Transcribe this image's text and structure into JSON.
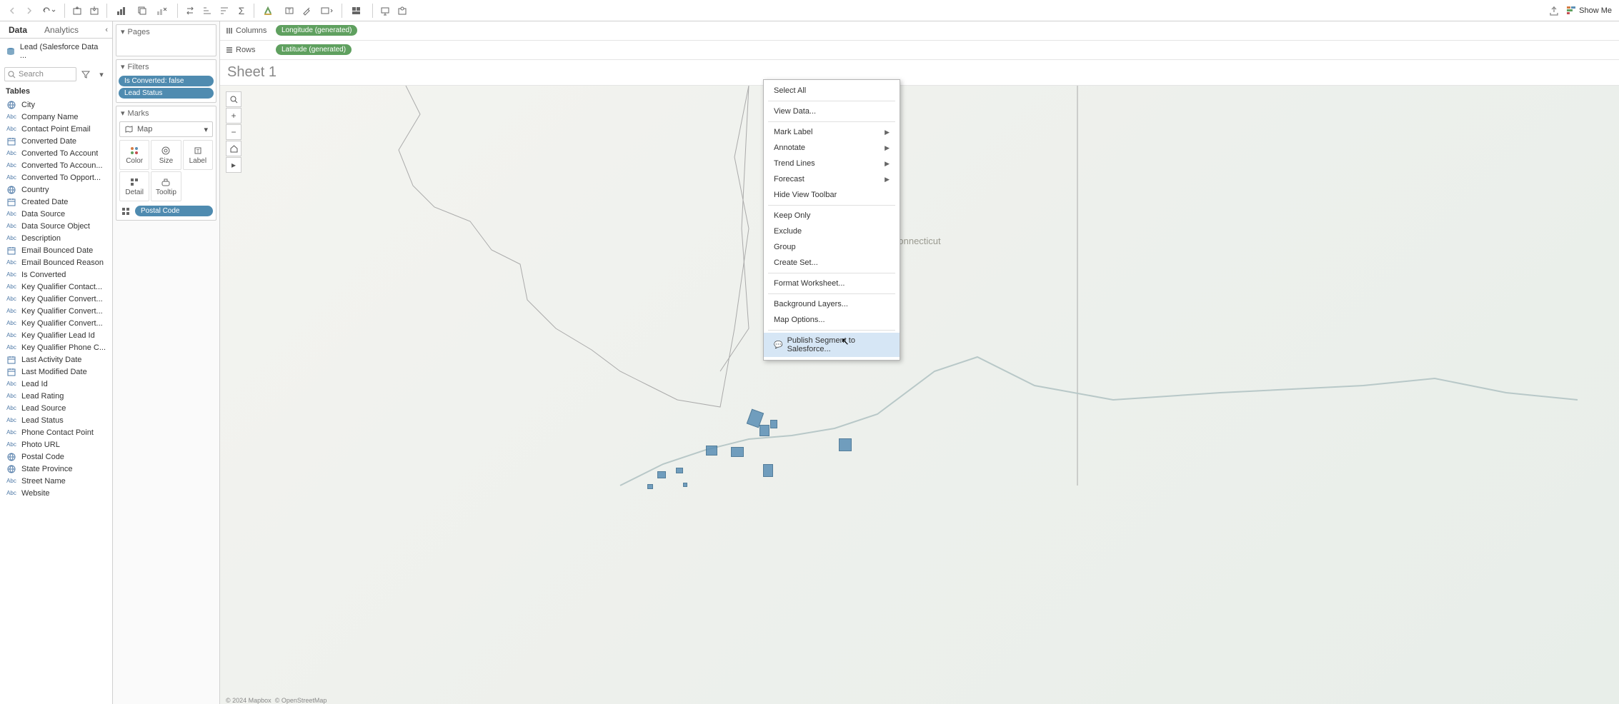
{
  "toolbar": {
    "showme": "Show Me"
  },
  "dataPane": {
    "tabs": {
      "data": "Data",
      "analytics": "Analytics"
    },
    "datasource": "Lead (Salesforce Data ...",
    "searchPlaceholder": "Search",
    "tablesHeader": "Tables",
    "fields": [
      {
        "icon": "globe",
        "name": "City"
      },
      {
        "icon": "abc",
        "name": "Company Name"
      },
      {
        "icon": "abc",
        "name": "Contact Point Email"
      },
      {
        "icon": "cal",
        "name": "Converted Date"
      },
      {
        "icon": "abc",
        "name": "Converted To Account"
      },
      {
        "icon": "abc",
        "name": "Converted To Accoun..."
      },
      {
        "icon": "abc",
        "name": "Converted To Opport..."
      },
      {
        "icon": "globe",
        "name": "Country"
      },
      {
        "icon": "cal",
        "name": "Created Date"
      },
      {
        "icon": "abc",
        "name": "Data Source"
      },
      {
        "icon": "abc",
        "name": "Data Source Object"
      },
      {
        "icon": "abc",
        "name": "Description"
      },
      {
        "icon": "cal",
        "name": "Email Bounced Date"
      },
      {
        "icon": "abc",
        "name": "Email Bounced Reason"
      },
      {
        "icon": "abc",
        "name": "Is Converted"
      },
      {
        "icon": "abc",
        "name": "Key Qualifier Contact..."
      },
      {
        "icon": "abc",
        "name": "Key Qualifier Convert..."
      },
      {
        "icon": "abc",
        "name": "Key Qualifier Convert..."
      },
      {
        "icon": "abc",
        "name": "Key Qualifier Convert..."
      },
      {
        "icon": "abc",
        "name": "Key Qualifier Lead Id"
      },
      {
        "icon": "abc",
        "name": "Key Qualifier Phone C..."
      },
      {
        "icon": "cal",
        "name": "Last Activity Date"
      },
      {
        "icon": "cal",
        "name": "Last Modified Date"
      },
      {
        "icon": "abc",
        "name": "Lead Id"
      },
      {
        "icon": "abc",
        "name": "Lead Rating"
      },
      {
        "icon": "abc",
        "name": "Lead Source"
      },
      {
        "icon": "abc",
        "name": "Lead Status"
      },
      {
        "icon": "abc",
        "name": "Phone Contact Point"
      },
      {
        "icon": "abc",
        "name": "Photo URL"
      },
      {
        "icon": "globe",
        "name": "Postal Code"
      },
      {
        "icon": "globe",
        "name": "State Province"
      },
      {
        "icon": "abc",
        "name": "Street Name"
      },
      {
        "icon": "abc",
        "name": "Website"
      }
    ]
  },
  "shelves": {
    "pages": "Pages",
    "filters": "Filters",
    "filterPills": [
      "Is Converted: false",
      "Lead Status"
    ],
    "marks": "Marks",
    "markType": "Map",
    "markCells": [
      "Color",
      "Size",
      "Label",
      "Detail",
      "Tooltip"
    ],
    "detailPill": "Postal Code"
  },
  "rowsCols": {
    "columnsLabel": "Columns",
    "columnsPill": "Longitude (generated)",
    "rowsLabel": "Rows",
    "rowsPill": "Latitude (generated)"
  },
  "sheetTitle": "Sheet 1",
  "mapLabel": "Connecticut",
  "attribution": {
    "mapbox": "© 2024 Mapbox",
    "osm": "© OpenStreetMap"
  },
  "contextMenu": {
    "selectAll": "Select All",
    "viewData": "View Data...",
    "markLabel": "Mark Label",
    "annotate": "Annotate",
    "trendLines": "Trend Lines",
    "forecast": "Forecast",
    "hideToolbar": "Hide View Toolbar",
    "keepOnly": "Keep Only",
    "exclude": "Exclude",
    "group": "Group",
    "createSet": "Create Set...",
    "formatWs": "Format Worksheet...",
    "bgLayers": "Background Layers...",
    "mapOptions": "Map Options...",
    "publish": "Publish Segment to Salesforce..."
  }
}
